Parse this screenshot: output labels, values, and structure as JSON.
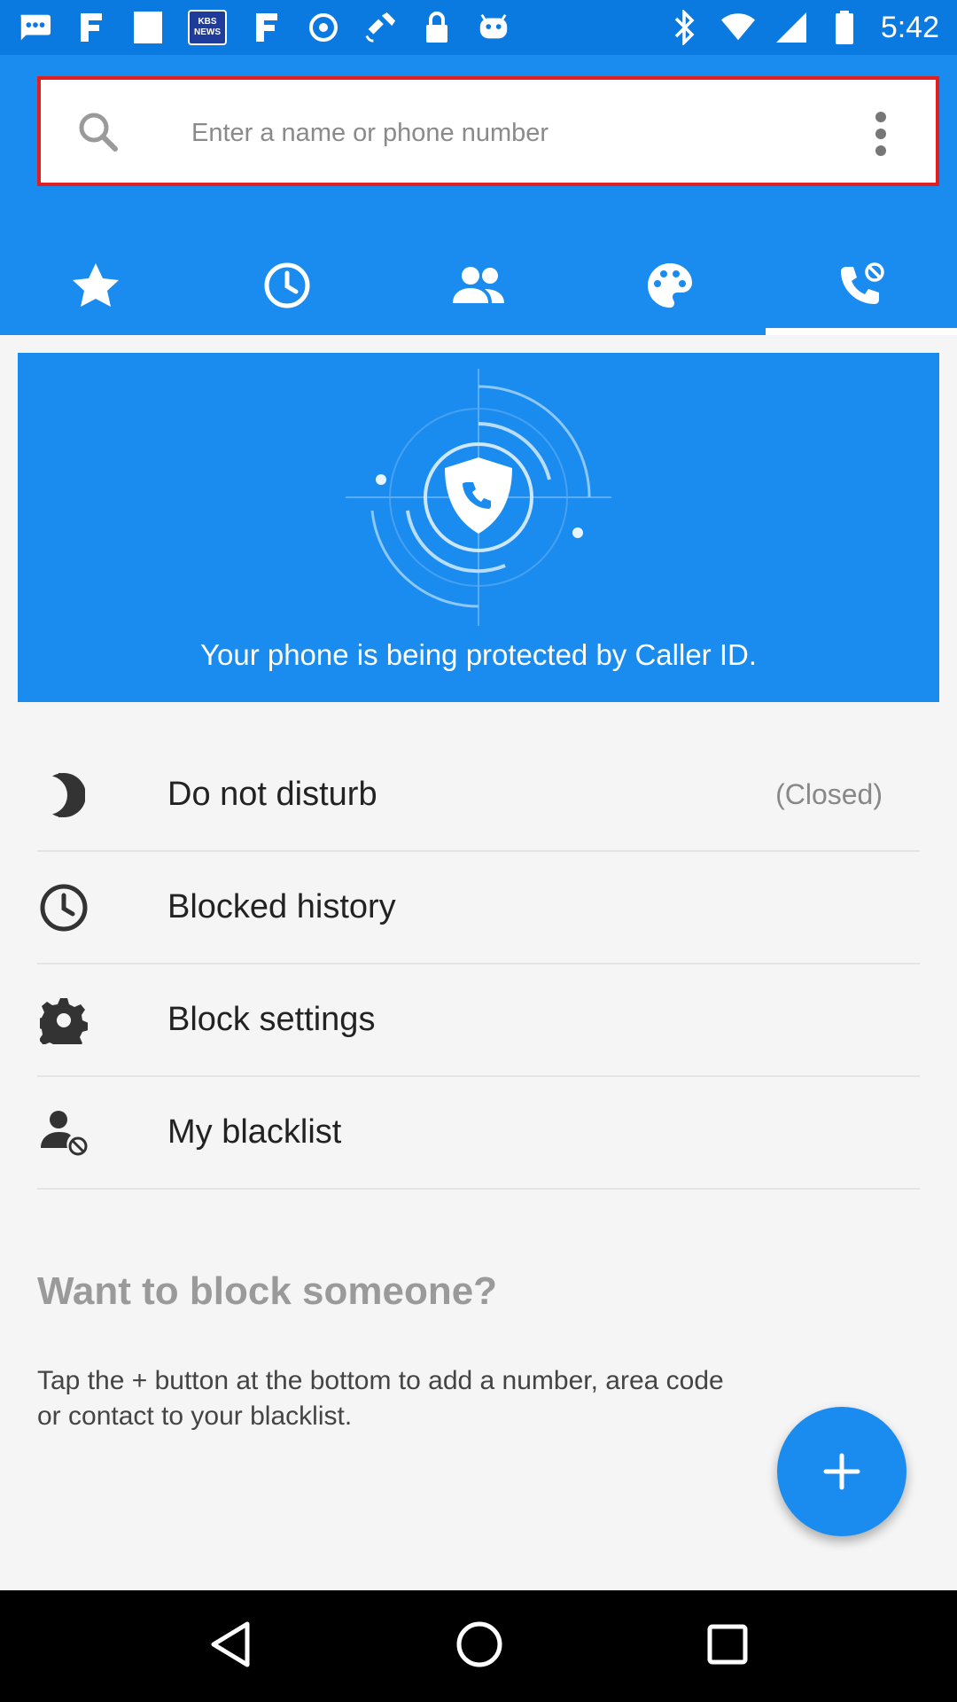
{
  "status_bar": {
    "kbs_badge": "KBS NEWS",
    "time": "5:42"
  },
  "search": {
    "placeholder": "Enter a name or phone number",
    "value": ""
  },
  "tabs": [
    {
      "icon": "star-icon",
      "active": false
    },
    {
      "icon": "clock-icon",
      "active": false
    },
    {
      "icon": "contacts-icon",
      "active": false
    },
    {
      "icon": "palette-icon",
      "active": false
    },
    {
      "icon": "call-block-icon",
      "active": true
    }
  ],
  "banner": {
    "message": "Your phone is being protected by Caller ID."
  },
  "list": {
    "items": [
      {
        "label": "Do not disturb",
        "status": "(Closed)",
        "icon": "moon-icon"
      },
      {
        "label": "Blocked history",
        "icon": "clock-icon"
      },
      {
        "label": "Block settings",
        "icon": "gear-icon"
      },
      {
        "label": "My blacklist",
        "icon": "person-block-icon"
      }
    ]
  },
  "help": {
    "title": "Want to block someone?",
    "body": "Tap the + button at the bottom to add a number, area code or contact to your blacklist."
  },
  "colors": {
    "primary": "#1a8cf0",
    "status_bar": "#0b7ae0",
    "search_border": "#e02020"
  }
}
